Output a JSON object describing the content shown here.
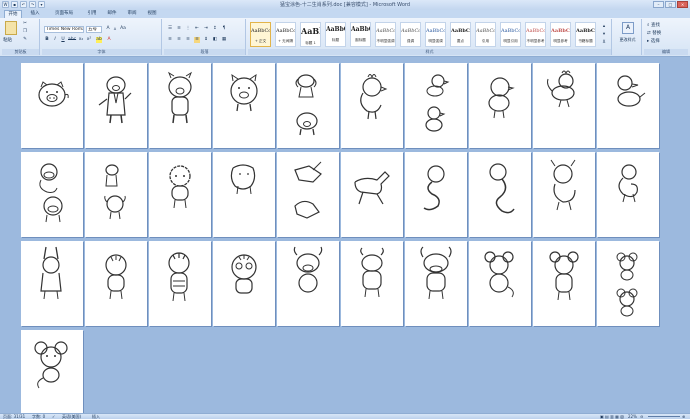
{
  "window": {
    "title": "猛宝涂色-十二生肖系列.doc [兼容模式] - Microsoft Word",
    "minimize": "–",
    "maximize": "□",
    "close": "×"
  },
  "quick_access": [
    "W",
    "▾",
    "↶",
    "↷"
  ],
  "tabs": [
    "开始",
    "插入",
    "页面布局",
    "引用",
    "邮件",
    "审阅",
    "视图"
  ],
  "ribbon": {
    "clipboard": {
      "paste": "粘贴",
      "label": "剪贴板"
    },
    "font": {
      "name": "Times New Roman",
      "size": "五号",
      "label": "字体",
      "bold": "B",
      "italic": "I",
      "underline": "U",
      "grow": "A",
      "color": "A",
      "clear": "Aa"
    },
    "paragraph": {
      "label": "段落",
      "bullets": "☰",
      "numbering": "≡",
      "align": "≡",
      "sort": "↕",
      "marks": "¶"
    },
    "styles": {
      "label": "样式",
      "items": [
        {
          "preview": "AaBbCcDc",
          "name": "+ 正文"
        },
        {
          "preview": "AaBbCcDc",
          "name": "+ 无间隔"
        },
        {
          "preview": "AaBl",
          "name": "标题 1"
        },
        {
          "preview": "AaBbC",
          "name": "标题"
        },
        {
          "preview": "AaBbC",
          "name": "副标题"
        },
        {
          "preview": "AaBbCcDc",
          "name": "不明显强调"
        },
        {
          "preview": "AaBbCcDc",
          "name": "强调"
        },
        {
          "preview": "AaBbCcDc",
          "name": "明显强调"
        },
        {
          "preview": "AaBbCcDc",
          "name": "要点"
        },
        {
          "preview": "AaBbCcDc",
          "name": "引用"
        },
        {
          "preview": "AaBbCcDc",
          "name": "明显引用"
        },
        {
          "preview": "AaBbCcDc",
          "name": "不明显参考"
        },
        {
          "preview": "AaBbCcDc",
          "name": "明显参考"
        },
        {
          "preview": "AaBbCcDc",
          "name": "书籍标题"
        }
      ],
      "change": "更改样式"
    },
    "editing": {
      "find": "查找",
      "replace": "替换",
      "select": "选择",
      "label": "编辑"
    }
  },
  "statusbar": {
    "page": "页面: 31/31",
    "words": "字数: 0",
    "lang": "英语(美国)",
    "mode": "插入",
    "zoom": "22%"
  }
}
